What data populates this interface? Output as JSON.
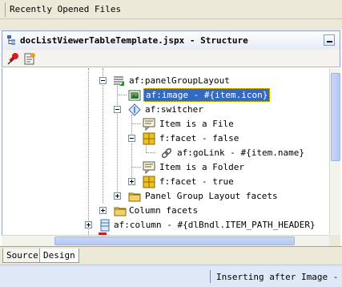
{
  "recent_files": {
    "label": "Recently Opened Files"
  },
  "panel": {
    "title": "docListViewerTableTemplate.jspx - Structure"
  },
  "tree": {
    "nodes": [
      {
        "label": "af:panelGroupLayout"
      },
      {
        "label": "af:image - #{item.icon}"
      },
      {
        "label": "af:switcher"
      },
      {
        "label": "Item is a File"
      },
      {
        "label": "f:facet - false"
      },
      {
        "label": "af:goLink - #{item.name}"
      },
      {
        "label": "Item is a Folder"
      },
      {
        "label": "f:facet - true"
      },
      {
        "label": "Panel Group Layout facets"
      },
      {
        "label": "Column facets"
      },
      {
        "label": "af:column - #{dlBndl.ITEM_PATH_HEADER}"
      }
    ]
  },
  "tabs": [
    {
      "label": "Source"
    },
    {
      "label": "Design"
    }
  ],
  "status": {
    "text": "Inserting after Image - #{"
  },
  "colors": {
    "selection": "#316ac5",
    "panel_border": "#8fa3c7",
    "status_bg": "#dfe8f6"
  },
  "icons": [
    "panel-tree-icon",
    "pin-icon",
    "properties-icon",
    "minimize-icon",
    "layout-icon",
    "image-icon",
    "switcher-icon",
    "comment-icon",
    "facet-icon",
    "link-icon",
    "folder-icon",
    "column-icon"
  ]
}
